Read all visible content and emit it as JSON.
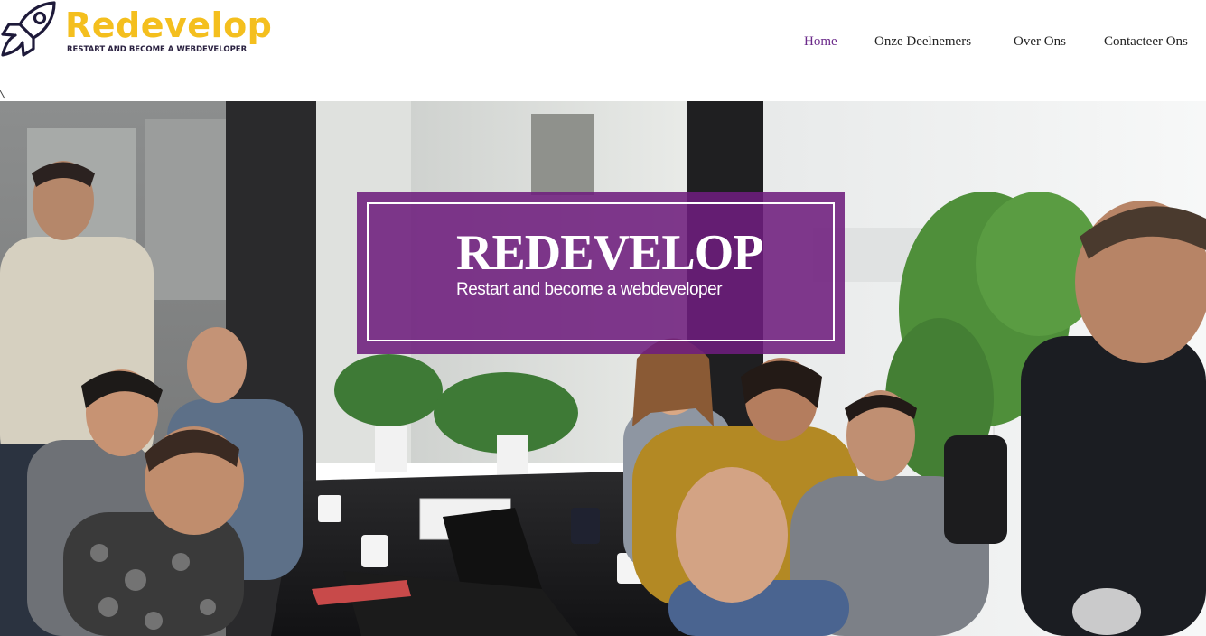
{
  "brand": {
    "title": "Redevelop",
    "tagline": "RESTART AND BECOME A WEBDEVELOPER",
    "logo_icon": "rocket-icon",
    "colors": {
      "title": "#f4bf1e",
      "tagline": "#2a2140"
    }
  },
  "nav": {
    "items": [
      {
        "label": "Home",
        "active": true
      },
      {
        "label": "Onze Deelnemers",
        "active": false
      },
      {
        "label": "Over Ons",
        "active": false
      },
      {
        "label": "Contacteer Ons",
        "active": false
      }
    ],
    "active_color": "#6b2a8a"
  },
  "hero": {
    "title": "REDEVELOP",
    "subtitle": "Restart and become a webdeveloper",
    "overlay_color": "#6e1e7d"
  }
}
